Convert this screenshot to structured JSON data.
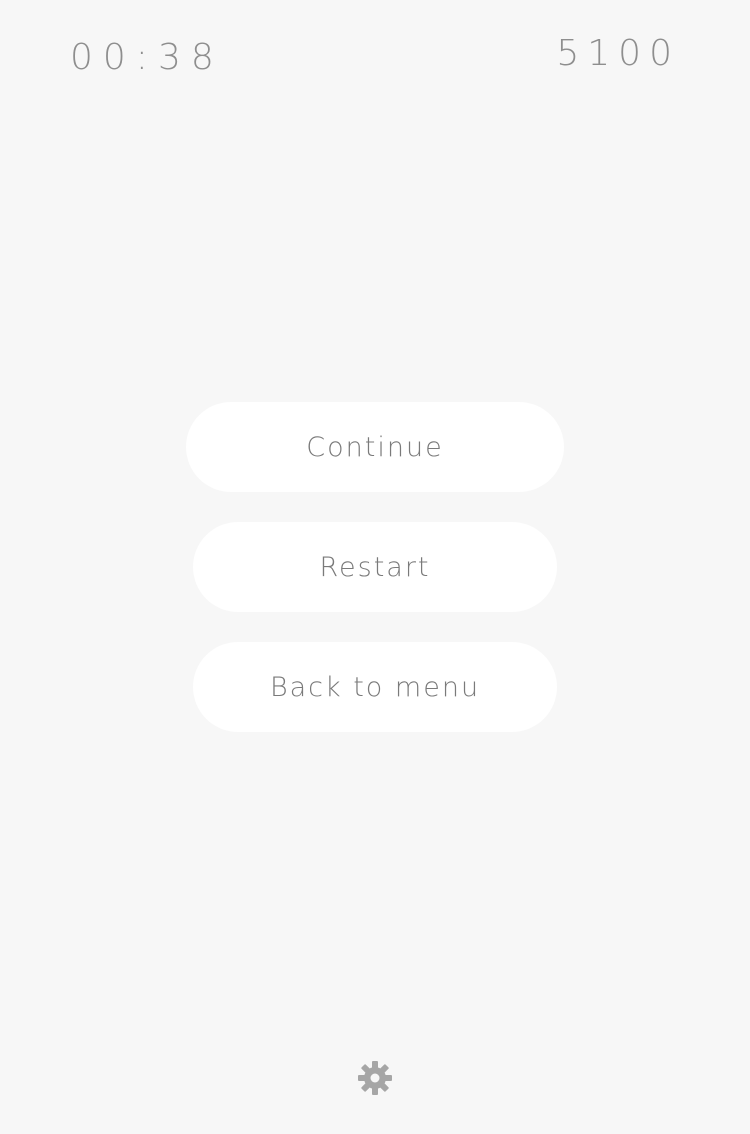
{
  "hud": {
    "timer": "00:38",
    "score": "5100"
  },
  "menu": {
    "continue_label": "Continue",
    "restart_label": "Restart",
    "back_label": "Back to menu"
  },
  "icons": {
    "settings": "gear-icon"
  },
  "colors": {
    "background": "#f7f7f7",
    "button": "#ffffff",
    "text": "#8e8e8e",
    "icon": "#a6a6a6"
  }
}
